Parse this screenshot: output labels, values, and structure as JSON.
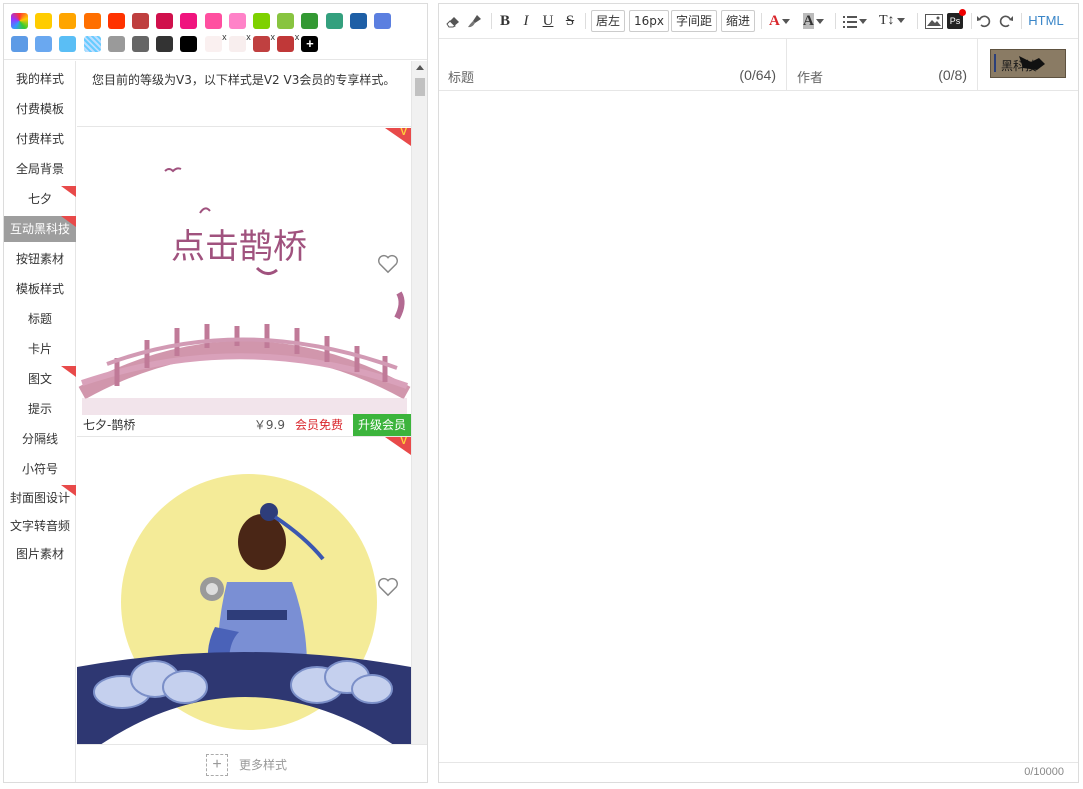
{
  "palette": {
    "colors": [
      "rainbow",
      "#FFCC00",
      "#FFA500",
      "#FF6F00",
      "#FF3300",
      "#BF3F3F",
      "#D0104C",
      "#F0147E",
      "#FF4FA0",
      "#FF82C8",
      "#7ED100",
      "#88C440",
      "#339933",
      "#34A07E",
      "#1E5FA6",
      "#5B7FE0",
      "#5D9BE6",
      "#6AA8F0",
      "#5ABEF5",
      "dotted",
      "#9A9A9A",
      "#666666",
      "#333333",
      "#000000",
      "#FAF0F0",
      "#F8EEEE",
      "#C04040",
      "#C03838",
      "add"
    ],
    "add_label": "+"
  },
  "categories": [
    {
      "label": "我的样式",
      "badge": false
    },
    {
      "label": "付费模板",
      "badge": false
    },
    {
      "label": "付费样式",
      "badge": false
    },
    {
      "label": "全局背景",
      "badge": false
    },
    {
      "label": "七夕",
      "badge": true
    },
    {
      "label": "互动黑科技",
      "badge": true,
      "active": true
    },
    {
      "label": "按钮素材",
      "badge": false
    },
    {
      "label": "模板样式",
      "badge": false
    },
    {
      "label": "标题",
      "badge": false
    },
    {
      "label": "卡片",
      "badge": false
    },
    {
      "label": "图文",
      "badge": true
    },
    {
      "label": "提示",
      "badge": false
    },
    {
      "label": "分隔线",
      "badge": false
    },
    {
      "label": "小符号",
      "badge": false
    },
    {
      "label": "封面图设计",
      "badge": true
    },
    {
      "label": "文字转音频",
      "badge": false
    },
    {
      "label": "图片素材",
      "badge": false
    }
  ],
  "notice": "您目前的等级为V3，以下样式是V2 V3会员的专享样式。",
  "cards": [
    {
      "name": "七夕-鹊桥",
      "price": "￥9.9",
      "free_label": "会员免费",
      "upgrade_label": "升级会员",
      "image_text": "点击鹊桥"
    },
    {
      "name": "",
      "price": "",
      "free_label": "",
      "upgrade_label": "",
      "image_text": ""
    }
  ],
  "badge_glyph": "V",
  "more_styles": {
    "icon": "+",
    "label": "更多样式"
  },
  "toolbar": {
    "bold": "B",
    "italic": "I",
    "underline": "U",
    "strike": "S",
    "align": "居左",
    "font_size": "16px",
    "letter_spacing": "字间距",
    "indent": "缩进",
    "font_color": "A",
    "bg_color": "A",
    "line_height": "T↕",
    "ps": "Ps",
    "html": "HTML"
  },
  "title_field": {
    "label": "标题",
    "count": "(0/64)"
  },
  "author_field": {
    "label": "作者",
    "count": "(0/8)"
  },
  "cover_thumb_text": "黑科技",
  "status": {
    "char_count": "0/10000"
  },
  "colors": {
    "accent": "#3A86C8",
    "badge_red": "#E84A4A",
    "upgrade_green": "#3CB43C",
    "free_red": "#D9262C"
  }
}
